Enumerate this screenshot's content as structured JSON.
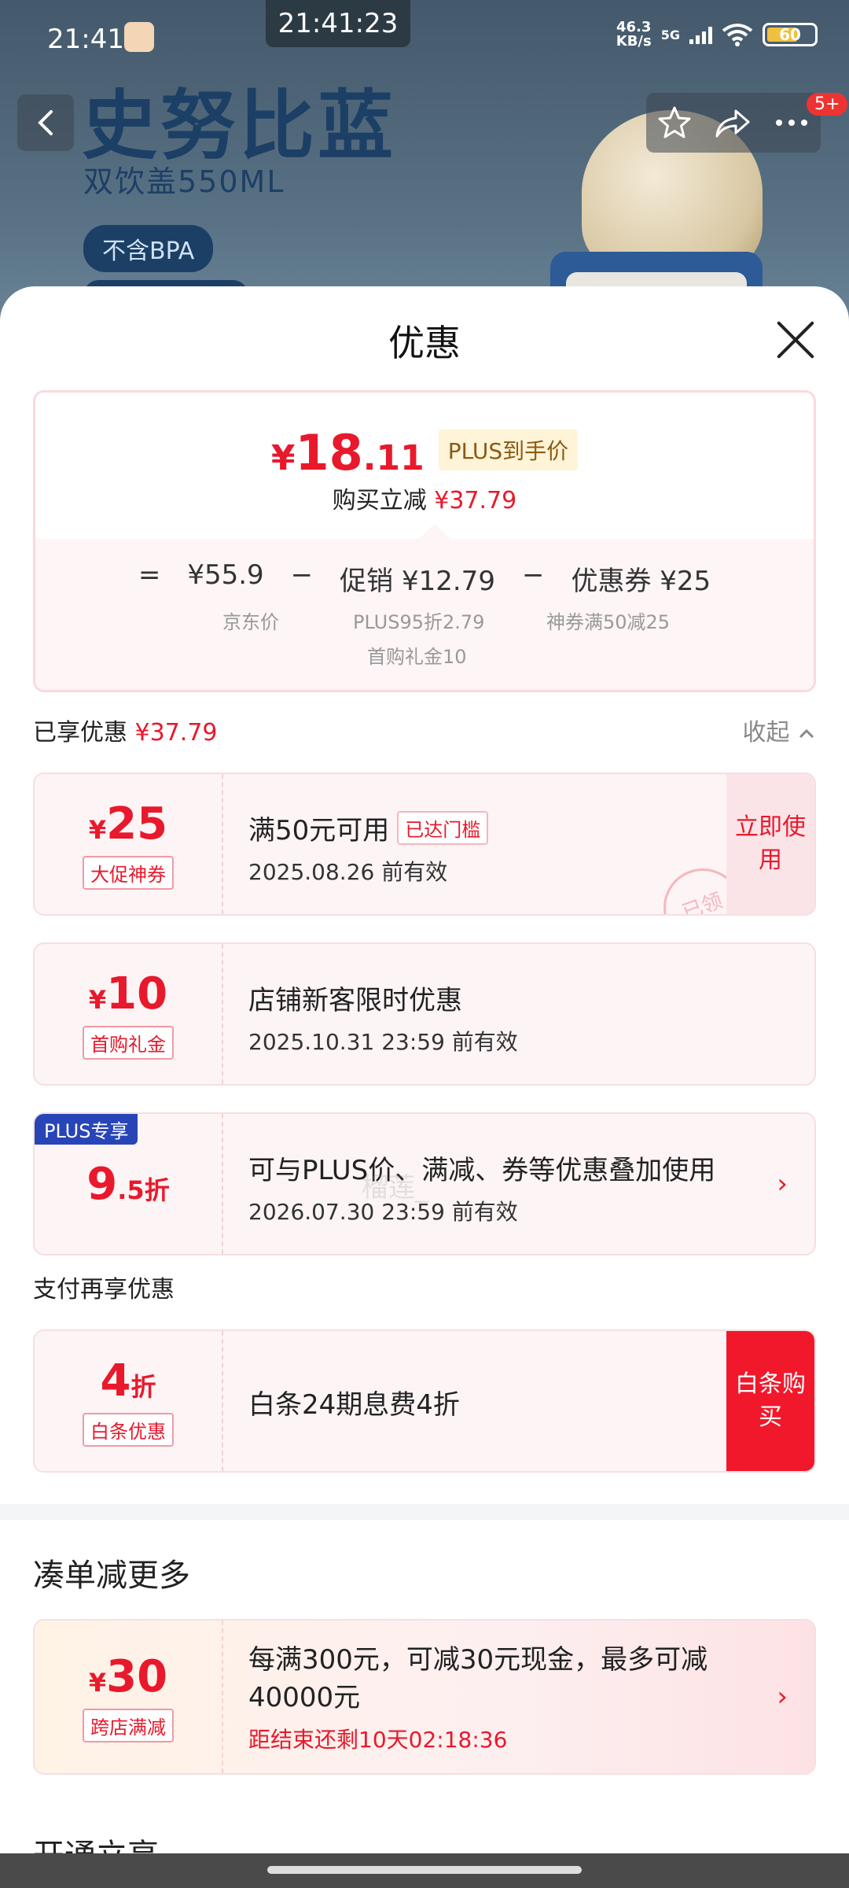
{
  "status_bar": {
    "time": "21:41",
    "center_time": "21:41:23",
    "net_speed_value": "46.3",
    "net_speed_unit": "KB/s",
    "net_type": "5G",
    "battery_level": "60"
  },
  "product_header": {
    "title": "史努比蓝",
    "subtitle": "双饮盖550ML",
    "badge": "不含BPA",
    "cart_count": "5+"
  },
  "sheet": {
    "title": "优惠",
    "price": {
      "currency": "¥",
      "integer": "18",
      "decimal": ".11",
      "tag": "PLUS到手价",
      "reduce_label": "购买立减",
      "reduce_value": "¥37.79"
    },
    "formula": {
      "eq": "=",
      "jd_price": "¥55.9",
      "minus1": "−",
      "promo": "促销 ¥12.79",
      "minus2": "−",
      "coupon": "优惠券 ¥25",
      "jd_price_label": "京东价",
      "promo_detail_1": "PLUS95折2.79",
      "promo_detail_2": "首购礼金10",
      "coupon_detail": "神券满50减25"
    },
    "enjoyed": {
      "label": "已享优惠",
      "value": "¥37.79",
      "collapse": "收起"
    },
    "coupons": [
      {
        "currency": "¥",
        "amount": "25",
        "tag": "大促神券",
        "title": "满50元可用",
        "badge": "已达门槛",
        "validity": "2025.08.26 前有效",
        "action": "立即使用",
        "stamp": "已领"
      },
      {
        "currency": "¥",
        "amount": "10",
        "tag": "首购礼金",
        "title": "店铺新客限时优惠",
        "validity": "2025.10.31 23:59 前有效"
      },
      {
        "plus_badge": "PLUS专享",
        "amount": "9",
        "amount_suffix": ".5折",
        "title": "可与PLUS价、满减、券等优惠叠加使用",
        "validity": "2026.07.30 23:59 前有效"
      }
    ],
    "watermark": "榴莲_",
    "pay_section": {
      "title": "支付再享优惠",
      "amount": "4",
      "amount_suffix": "折",
      "tag": "白条优惠",
      "text": "白条24期息费4折",
      "action": "白条购买"
    },
    "more_section": {
      "title": "凑单减更多",
      "currency": "¥",
      "amount": "30",
      "tag": "跨店满减",
      "text": "每满300元，可减30元现金，最多可减40000元",
      "countdown": "距结束还剩10天02:18:36"
    },
    "next_section_title": "开通立享"
  }
}
